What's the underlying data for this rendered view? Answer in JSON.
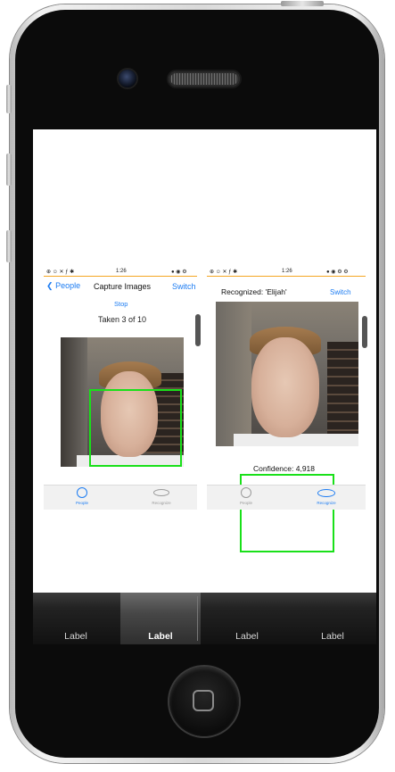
{
  "left_screen": {
    "status_time": "1:26",
    "back_label": "People",
    "title": "Capture Images",
    "switch_label": "Switch",
    "stop_label": "Stop",
    "progress_text": "Taken 3 of 10",
    "tabs": [
      {
        "label": "People",
        "icon": "person-icon",
        "active": true
      },
      {
        "label": "Recognize",
        "icon": "eye-icon",
        "active": false
      }
    ]
  },
  "right_screen": {
    "status_time": "1:26",
    "recognized_text": "Recognized: 'Elijah'",
    "switch_label": "Switch",
    "confidence_text": "Confidence: 4,918",
    "tabs": [
      {
        "label": "People",
        "icon": "person-icon",
        "active": false
      },
      {
        "label": "Recognize",
        "icon": "eye-icon",
        "active": true
      }
    ]
  },
  "tabbar": {
    "items": [
      {
        "label": "Label"
      },
      {
        "label": "Label"
      },
      {
        "label": "Label"
      },
      {
        "label": "Label"
      }
    ],
    "selected_index": 1
  },
  "colors": {
    "accent": "#1c7cf2",
    "face_box": "#19e019",
    "status_divider": "#f5a623"
  }
}
